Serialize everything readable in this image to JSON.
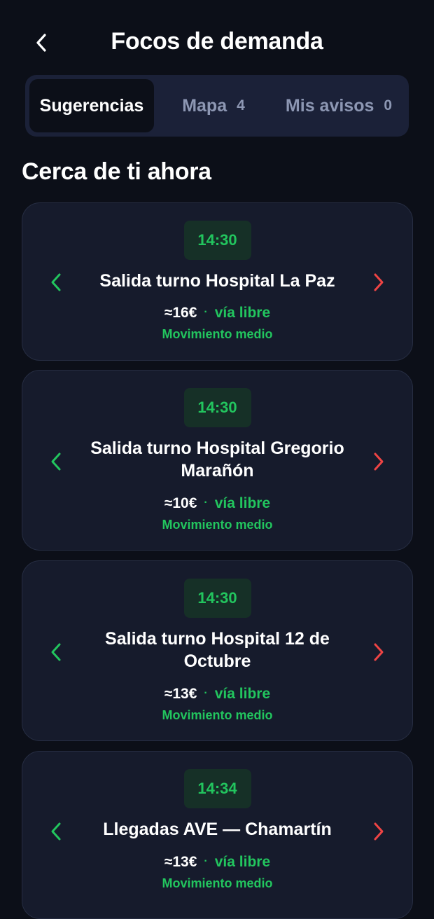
{
  "header": {
    "title": "Focos de demanda",
    "back_icon": "chevron-left-icon"
  },
  "tabs": [
    {
      "label": "Sugerencias",
      "count": ""
    },
    {
      "label": "Mapa",
      "count": "4"
    },
    {
      "label": "Mis avisos",
      "count": "0"
    }
  ],
  "section": {
    "title": "Cerca de ti ahora"
  },
  "colors": {
    "accent_green": "#22c55e",
    "accent_red": "#ef4444",
    "background": "#0c0f18",
    "card": "#161b2c"
  },
  "cards": [
    {
      "time": "14:30",
      "title": "Salida turno Hospital La Paz",
      "price": "≈16€",
      "separator": "·",
      "traffic": "vía libre",
      "movement": "Movimiento medio"
    },
    {
      "time": "14:30",
      "title": "Salida turno Hospital Gregorio Marañón",
      "price": "≈10€",
      "separator": "·",
      "traffic": "vía libre",
      "movement": "Movimiento medio"
    },
    {
      "time": "14:30",
      "title": "Salida turno Hospital 12 de Octubre",
      "price": "≈13€",
      "separator": "·",
      "traffic": "vía libre",
      "movement": "Movimiento medio"
    },
    {
      "time": "14:34",
      "title": "Llegadas AVE — Chamartín",
      "price": "≈13€",
      "separator": "·",
      "traffic": "vía libre",
      "movement": "Movimiento medio"
    }
  ]
}
